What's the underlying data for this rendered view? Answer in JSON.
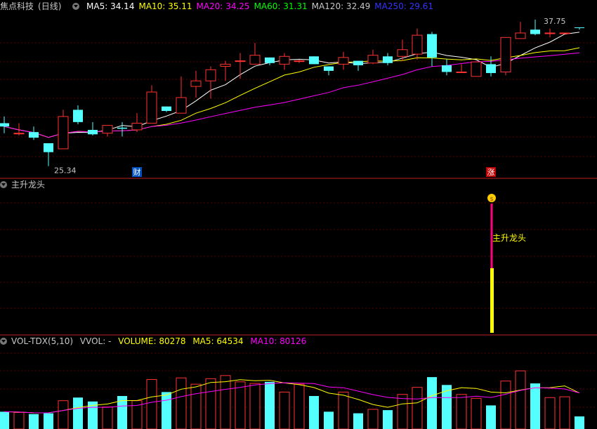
{
  "main": {
    "stock_name": "焦点科技",
    "period": "(日线)",
    "ma": [
      {
        "label": "MA5: 34.14",
        "color": "#ffffff"
      },
      {
        "label": "MA10: 35.11",
        "color": "#ffff00"
      },
      {
        "label": "MA20: 34.25",
        "color": "#ff00ff"
      },
      {
        "label": "MA60: 31.31",
        "color": "#00ff00"
      },
      {
        "label": "MA120: 32.49",
        "color": "#c8c8c8"
      },
      {
        "label": "MA250: 29.61",
        "color": "#3333ff"
      }
    ],
    "high_label": "37.75",
    "low_label": "25.34",
    "marker_cai": "财",
    "marker_zhang": "涨"
  },
  "indicator": {
    "title": "主升龙头",
    "signal_label": "主升龙头"
  },
  "volume": {
    "title": "VOL-TDX(5,10)",
    "vvol": "VVOL: -",
    "volume": "VOLUME: 80278",
    "ma5": "MA5: 64534",
    "ma10": "MA10: 80126"
  },
  "colors": {
    "up": "#ff3232",
    "down": "#54ffff",
    "volume_label": "#ffff00",
    "ma10_vol": "#ff00ff",
    "signal_bar": "#ffff00",
    "signal_line": "#ff0080"
  },
  "chart_data": {
    "type": "candlestick",
    "price_range": [
      24.5,
      39.0
    ],
    "candles": [
      {
        "o": 29.2,
        "h": 29.8,
        "c": 28.9,
        "l": 28.3
      },
      {
        "o": 28.3,
        "h": 29.2,
        "c": 28.3,
        "l": 28.1
      },
      {
        "o": 28.4,
        "h": 28.9,
        "c": 27.9,
        "l": 27.7
      },
      {
        "o": 27.4,
        "h": 27.4,
        "c": 26.6,
        "l": 25.34
      },
      {
        "o": 26.9,
        "h": 30.4,
        "c": 29.8,
        "l": 26.9
      },
      {
        "o": 30.4,
        "h": 30.8,
        "c": 29.3,
        "l": 29.1
      },
      {
        "o": 28.6,
        "h": 29.3,
        "c": 28.2,
        "l": 28.1
      },
      {
        "o": 28.3,
        "h": 29.0,
        "c": 29.0,
        "l": 28.0
      },
      {
        "o": 28.8,
        "h": 29.3,
        "c": 28.7,
        "l": 28.0
      },
      {
        "o": 28.6,
        "h": 30.1,
        "c": 29.2,
        "l": 28.4
      },
      {
        "o": 29.2,
        "h": 32.6,
        "c": 32.0,
        "l": 29.2
      },
      {
        "o": 30.7,
        "h": 30.7,
        "c": 30.3,
        "l": 30.2
      },
      {
        "o": 30.1,
        "h": 33.4,
        "c": 31.5,
        "l": 30.1
      },
      {
        "o": 32.5,
        "h": 33.9,
        "c": 33.0,
        "l": 31.5
      },
      {
        "o": 33.0,
        "h": 34.3,
        "c": 34.0,
        "l": 31.4
      },
      {
        "o": 34.3,
        "h": 34.8,
        "c": 34.5,
        "l": 33.0
      },
      {
        "o": 34.8,
        "h": 35.5,
        "c": 34.8,
        "l": 33.2
      },
      {
        "o": 34.5,
        "h": 36.4,
        "c": 35.3,
        "l": 34.5
      },
      {
        "o": 35.1,
        "h": 35.1,
        "c": 34.6,
        "l": 34.4
      },
      {
        "o": 34.5,
        "h": 35.5,
        "c": 35.2,
        "l": 34.0
      },
      {
        "o": 34.8,
        "h": 34.9,
        "c": 34.8,
        "l": 34.6
      },
      {
        "o": 35.2,
        "h": 35.2,
        "c": 34.5,
        "l": 34.5
      },
      {
        "o": 34.3,
        "h": 34.3,
        "c": 33.9,
        "l": 33.5
      },
      {
        "o": 34.5,
        "h": 35.6,
        "c": 35.1,
        "l": 34.0
      },
      {
        "o": 34.8,
        "h": 34.8,
        "c": 34.4,
        "l": 33.9
      },
      {
        "o": 34.6,
        "h": 35.8,
        "c": 35.3,
        "l": 34.5
      },
      {
        "o": 35.2,
        "h": 35.5,
        "c": 34.6,
        "l": 34.4
      },
      {
        "o": 35.2,
        "h": 36.7,
        "c": 35.8,
        "l": 34.8
      },
      {
        "o": 35.4,
        "h": 37.7,
        "c": 37.1,
        "l": 34.9
      },
      {
        "o": 37.2,
        "h": 37.4,
        "c": 35.1,
        "l": 34.3
      },
      {
        "o": 34.4,
        "h": 35.0,
        "c": 33.8,
        "l": 33.5
      },
      {
        "o": 33.8,
        "h": 34.5,
        "c": 33.8,
        "l": 33.8
      },
      {
        "o": 33.4,
        "h": 34.7,
        "c": 34.7,
        "l": 33.4
      },
      {
        "o": 34.5,
        "h": 35.2,
        "c": 33.7,
        "l": 33.4
      },
      {
        "o": 33.8,
        "h": 36.9,
        "c": 36.9,
        "l": 33.5
      },
      {
        "o": 36.8,
        "h": 38.3,
        "c": 37.3,
        "l": 36.8
      },
      {
        "o": 37.6,
        "h": 38.5,
        "c": 37.2,
        "l": 37.1
      },
      {
        "o": 37.3,
        "h": 37.7,
        "c": 37.3,
        "l": 36.9
      },
      {
        "o": 37.3,
        "h": 37.3,
        "c": 37.3,
        "l": 37.3
      },
      {
        "o": 37.8,
        "h": 37.8,
        "c": 37.75,
        "l": 37.6
      }
    ],
    "volume_range": [
      0,
      117000
    ],
    "volumes": [
      22000,
      21000,
      19000,
      20000,
      36000,
      40000,
      35000,
      28000,
      42000,
      36000,
      63000,
      47000,
      65000,
      57000,
      64000,
      68000,
      60000,
      58000,
      60000,
      47000,
      57000,
      42000,
      22000,
      47000,
      20000,
      25000,
      24000,
      44000,
      53000,
      66000,
      56000,
      44000,
      39000,
      30000,
      61000,
      74000,
      58000,
      40000,
      41000,
      16000
    ],
    "signal_index": 33,
    "cai_index": 9,
    "zhang_index": 33
  }
}
